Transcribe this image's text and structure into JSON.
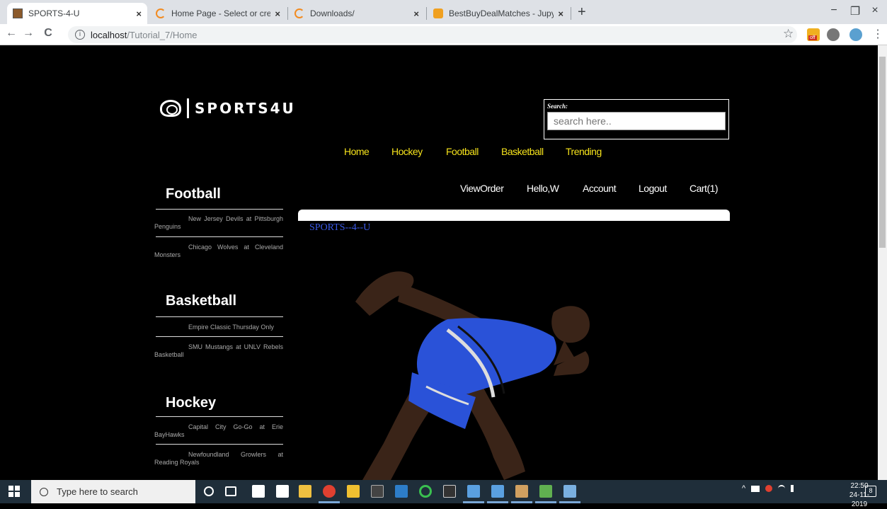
{
  "browser": {
    "tabs": [
      {
        "title": "SPORTS-4-U",
        "active": true
      },
      {
        "title": "Home Page - Select or create a n",
        "active": false
      },
      {
        "title": "Downloads/",
        "active": false
      },
      {
        "title": "BestBuyDealMatches - Jupyter N",
        "active": false
      }
    ],
    "tab_close": "×",
    "new_tab": "+",
    "window": {
      "minimize": "−",
      "maximize": "❐",
      "close": "×"
    },
    "nav": {
      "back": "←",
      "forward": "→",
      "reload": "C"
    },
    "url_host": "localhost",
    "url_path": "/Tutorial_7/Home",
    "bookmark_star": "☆",
    "ext_badge": "off",
    "menu": "⋮"
  },
  "site": {
    "logo_text": "SPORTS4U",
    "search_label": "Search:",
    "search_placeholder": "search here..",
    "primary_nav": [
      "Home",
      "Hockey",
      "Football",
      "Basketball",
      "Trending"
    ],
    "user_nav": [
      "ViewOrder",
      "Hello,W",
      "Account",
      "Logout",
      "Cart(1)"
    ],
    "site_tag": "SPORTS--4--U",
    "sidebar": [
      {
        "heading": "Football",
        "items": [
          "New Jersey Devils at Pittsburgh Penguins",
          "Chicago Wolves at Cleveland Monsters"
        ]
      },
      {
        "heading": "Basketball",
        "items": [
          "Empire Classic Thursday Only",
          "SMU Mustangs at UNLV Rebels Basketball"
        ]
      },
      {
        "heading": "Hockey",
        "items": [
          "Capital City Go-Go at Erie BayHawks",
          "Newfoundland Growlers at Reading Royals"
        ]
      }
    ]
  },
  "taskbar": {
    "search_placeholder": "Type here to search",
    "time": "22:50",
    "date": "24-11-2019",
    "notifications": "8",
    "tray_icons": "^"
  },
  "colors": {
    "nav_primary": "#f5e21b",
    "site_tag": "#3a59e6",
    "runner_suit": "#2a52d8"
  }
}
